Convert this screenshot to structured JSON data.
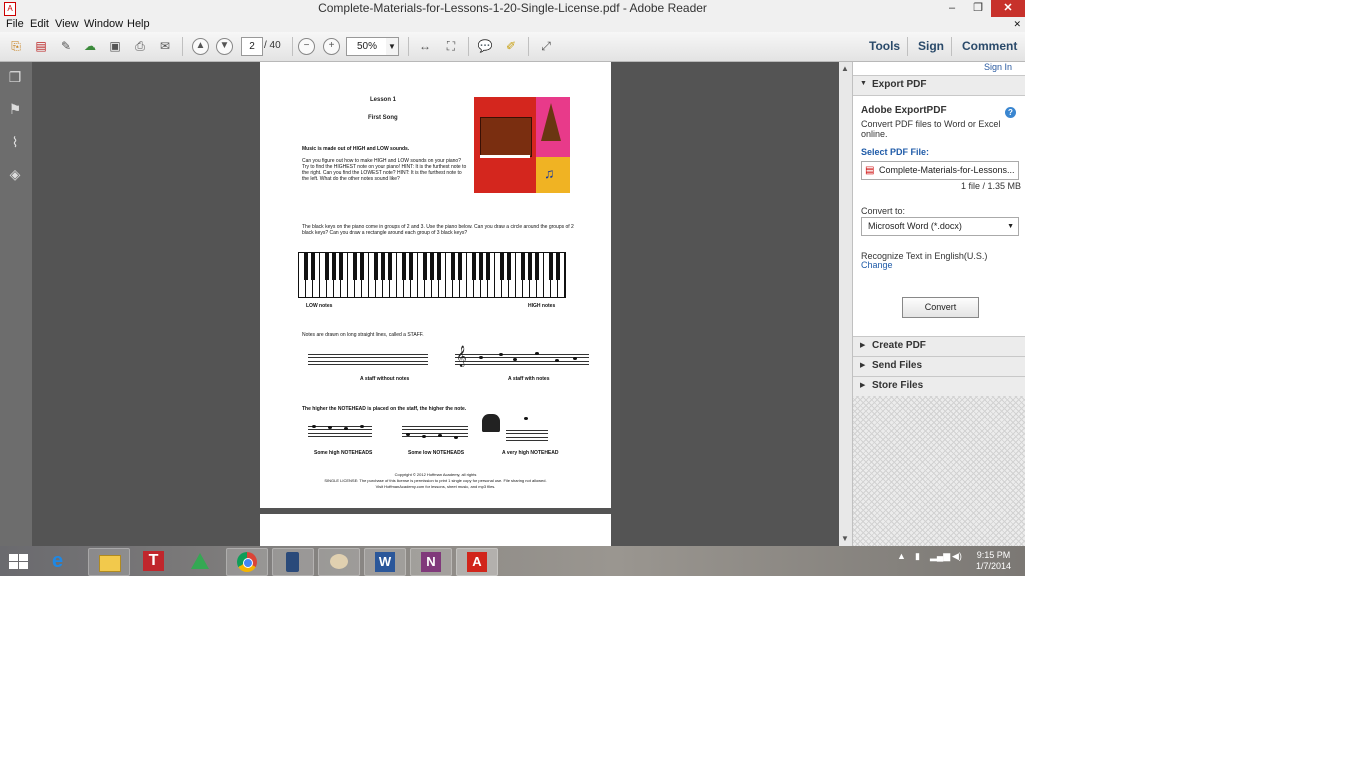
{
  "window": {
    "title": "Complete-Materials-for-Lessons-1-20-Single-License.pdf - Adobe Reader",
    "app_icon": "pdf-icon",
    "minimize": "–",
    "restore": "❐",
    "close": "✕"
  },
  "menu": {
    "items": [
      "File",
      "Edit",
      "View",
      "Window",
      "Help"
    ],
    "close_doc": "✕"
  },
  "toolbar": {
    "page_current": "2",
    "page_total": "/ 40",
    "zoom": "50%",
    "tools_label": "Tools",
    "sign_label": "Sign",
    "comment_label": "Comment"
  },
  "document": {
    "lesson_title": "Lesson 1",
    "song_title": "First Song",
    "intro": "Music is made out of HIGH and LOW sounds.",
    "question": "Can you figure out how to make HIGH and LOW sounds on your piano? Try to find the HIGHEST note on your piano! HINT: It is the furthest note to the right. Can you find the LOWEST note? HINT: It is the furthest note to the left. What do the other notes sound like?",
    "keys_text": "The black keys on the piano come in groups of 2 and 3. Use the piano below. Can you draw a circle around the groups of 2 black keys? Can you draw a rectangle around each group of 3 black keys?",
    "low_label": "LOW notes",
    "high_label": "HIGH notes",
    "staff_text": "Notes are drawn on long straight lines, called a STAFF.",
    "staff_without": "A staff without notes",
    "staff_with": "A staff with notes",
    "notehead_text": "The higher the NOTEHEAD is placed on the staff, the higher the note.",
    "cap_high": "Some high NOTEHEADS",
    "cap_low": "Some low NOTEHEADS",
    "cap_veryhigh": "A very high NOTEHEAD",
    "copyright": "Copyright © 2012 Hoffman Academy, all rights",
    "license": "SINGLE LICENSE: The purchase of this license is permission to print 1 single copy for personal use. File sharing not allowed.",
    "visit": "Visit HoffmanAcademy.com for lessons, sheet music, and mp3 files."
  },
  "right_panel": {
    "sign_in": "Sign In",
    "export_header": "Export PDF",
    "export_title": "Adobe ExportPDF",
    "export_desc": "Convert PDF files to Word or Excel online.",
    "select_label": "Select PDF File:",
    "file_name": "Complete-Materials-for-Lessons...",
    "file_info": "1 file / 1.35 MB",
    "convert_to_label": "Convert to:",
    "convert_to_value": "Microsoft Word (*.docx)",
    "recognize": "Recognize Text in English(U.S.)",
    "change": "Change",
    "convert_button": "Convert",
    "create_pdf": "Create PDF",
    "send_files": "Send Files",
    "store_files": "Store Files"
  },
  "taskbar": {
    "time": "9:15 PM",
    "date": "1/7/2014",
    "apps": [
      "start-windows-icon",
      "internet-explorer-icon",
      "file-explorer-icon",
      "t-app-icon",
      "google-drive-icon",
      "chrome-icon",
      "phone-app-icon",
      "paint-icon",
      "word-icon",
      "onenote-icon",
      "adobe-reader-icon"
    ]
  }
}
